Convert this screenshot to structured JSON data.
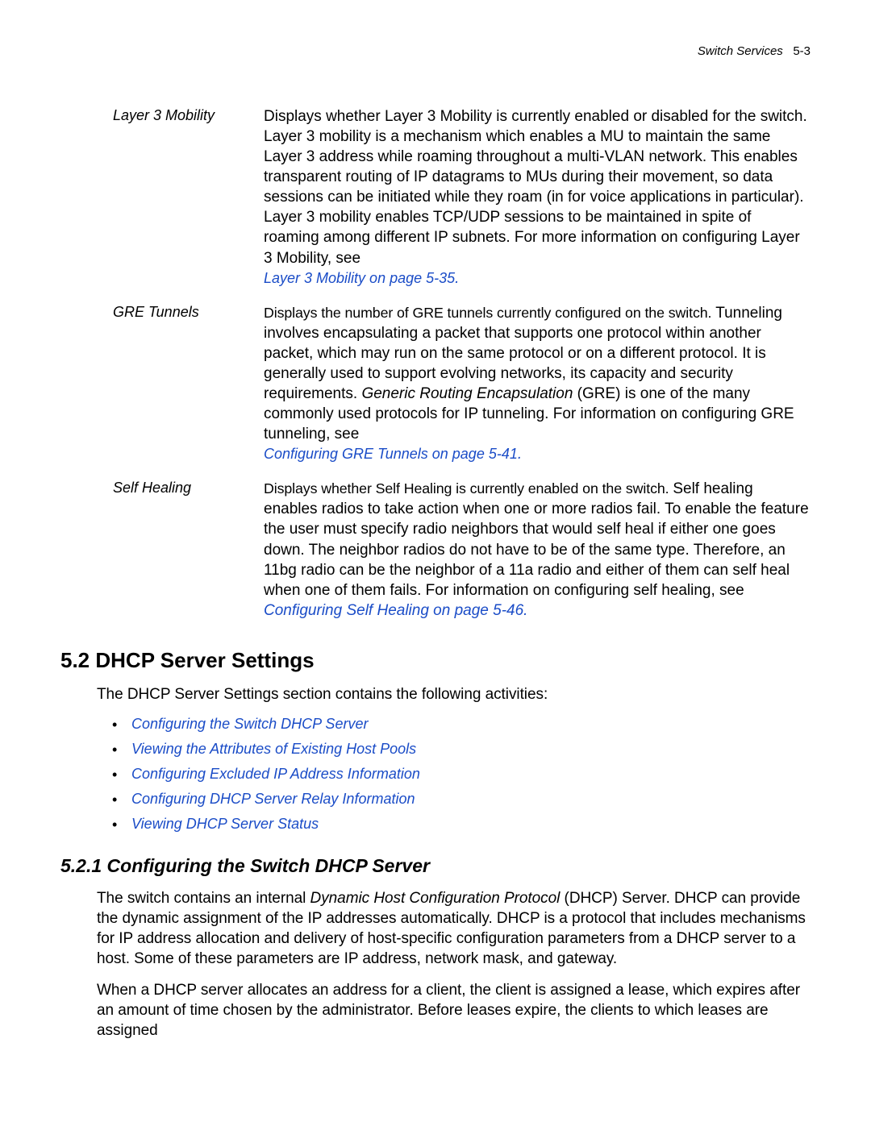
{
  "header": {
    "doc_title": "Switch Services",
    "page_ref": "5-3"
  },
  "definitions": [
    {
      "term": "Layer 3 Mobility",
      "body_pre": "Displays whether Layer 3 Mobility is currently enabled or disabled for the switch. Layer 3 mobility is a mechanism which enables a MU to maintain the same Layer 3 address while roaming throughout a multi-VLAN network. This enables transparent routing of IP datagrams to MUs during their movement, so data sessions can be initiated while they roam (in for voice applications in particular). Layer 3 mobility enables TCP/UDP sessions to be maintained in spite of roaming among different IP subnets. For more information on configuring Layer 3 Mobility, see ",
      "xref": "Layer 3 Mobility on page 5-35",
      "tight_lead": false,
      "italic_phrase": null
    },
    {
      "term": "GRE Tunnels",
      "body_pre": "Displays the number of GRE tunnels currently configured on the switch. ",
      "body_post": "Tunneling involves encapsulating a packet that supports one protocol within another packet, which may run on the same protocol or on a different protocol. It is generally used to support evolving networks, its capacity and security requirements. ",
      "italic_phrase": "Generic Routing Encapsulation",
      "body_tail": " (GRE) is one of the many commonly used protocols for IP tunneling. For information on configuring GRE tunneling, see ",
      "xref": "Configuring GRE Tunnels on page 5-41",
      "tight_lead": true
    },
    {
      "term": "Self Healing",
      "body_pre": "Displays whether Self Healing is currently enabled on the switch. ",
      "body_post": "Self healing enables radios to take action when one or more radios fail. To enable the feature the user must specify radio neighbors that would self heal if either one goes down. The neighbor radios do not have to be of the same type. Therefore, an 11bg radio can be the neighbor of a 11a radio and either of them can self heal when one of them fails. For information on configuring self healing, see ",
      "xref": "Configuring Self Healing on page 5-46",
      "tight_lead": true,
      "italic_phrase": null,
      "inline_xref": true
    }
  ],
  "section_heading": "5.2  DHCP Server Settings",
  "section_intro": "The DHCP Server Settings section contains the following activities:",
  "section_links": [
    "Configuring the Switch DHCP Server",
    "Viewing the Attributes of Existing Host Pools",
    "Configuring Excluded IP Address Information",
    "Configuring DHCP Server Relay Information",
    "Viewing DHCP Server Status"
  ],
  "subsection_heading": "5.2.1  Configuring the Switch DHCP Server",
  "subsection_para1_pre": "The switch contains an internal ",
  "subsection_para1_italic": "Dynamic Host Configuration Protocol",
  "subsection_para1_post": " (DHCP) Server. DHCP can provide the dynamic assignment of the IP addresses automatically. DHCP is a protocol that includes mechanisms for IP address allocation and delivery of host-specific configuration parameters from a DHCP server to a host. Some of these parameters are IP address, network mask, and gateway.",
  "subsection_para2": "When a DHCP server allocates an address for a client, the client is assigned a lease, which expires after an amount of time chosen by the administrator. Before leases expire, the clients to which leases are assigned"
}
